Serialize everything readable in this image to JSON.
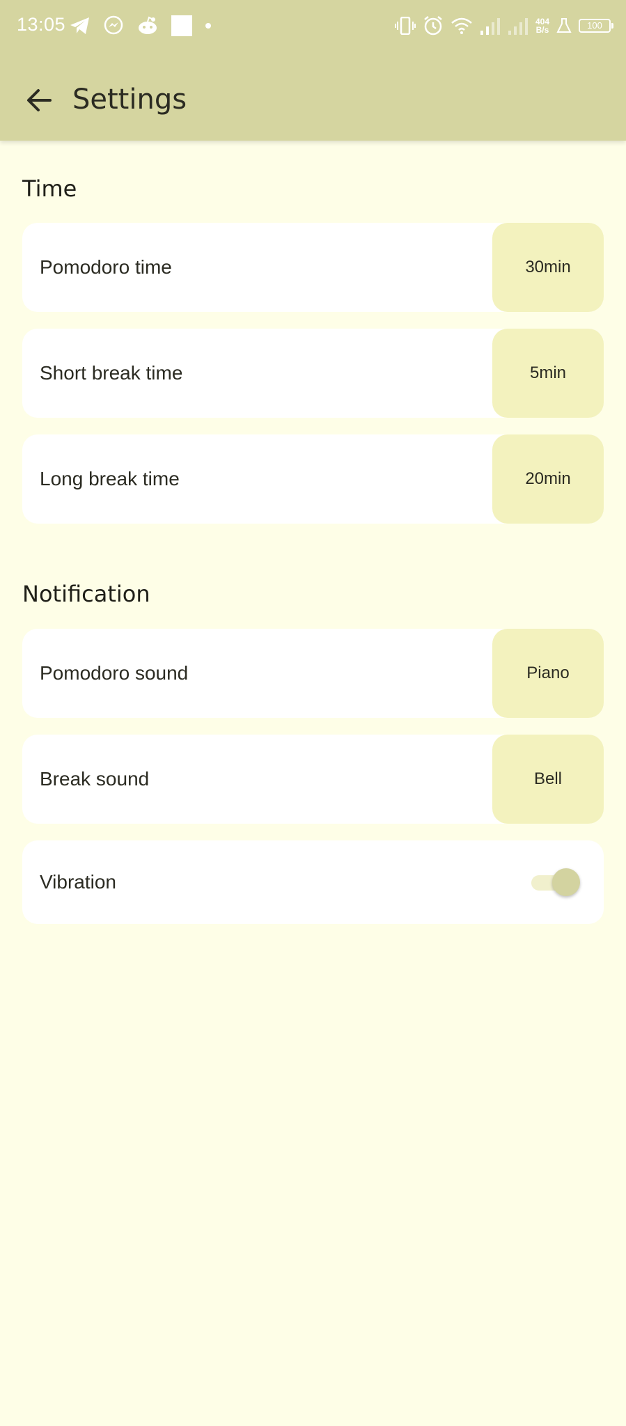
{
  "status_bar": {
    "time": "13:05",
    "net_speed_value": "404",
    "net_speed_unit": "B/s",
    "battery": "100",
    "left_icons": [
      "telegram-icon",
      "messenger-icon",
      "reddit-icon",
      "square-icon",
      "dot-icon"
    ],
    "right_icons": [
      "vibrate-icon",
      "alarm-icon",
      "wifi-icon",
      "signal-icon",
      "signal-icon",
      "flask-icon",
      "battery-icon"
    ]
  },
  "app_bar": {
    "title": "Settings",
    "back_icon": "arrow-back-icon"
  },
  "sections": {
    "time": {
      "title": "Time",
      "items": [
        {
          "label": "Pomodoro time",
          "value": "30min"
        },
        {
          "label": "Short break time",
          "value": "5min"
        },
        {
          "label": "Long break time",
          "value": "20min"
        }
      ]
    },
    "notification": {
      "title": "Notification",
      "items": [
        {
          "label": "Pomodoro sound",
          "value": "Piano"
        },
        {
          "label": "Break sound",
          "value": "Bell"
        }
      ],
      "vibration": {
        "label": "Vibration",
        "enabled": true
      }
    }
  },
  "colors": {
    "topbar": "#d5d5a0",
    "background": "#fefee7",
    "card": "#ffffff",
    "value_chip": "#f3f2be",
    "switch_thumb": "#d3d3a0",
    "switch_track": "#f1f0cd"
  }
}
